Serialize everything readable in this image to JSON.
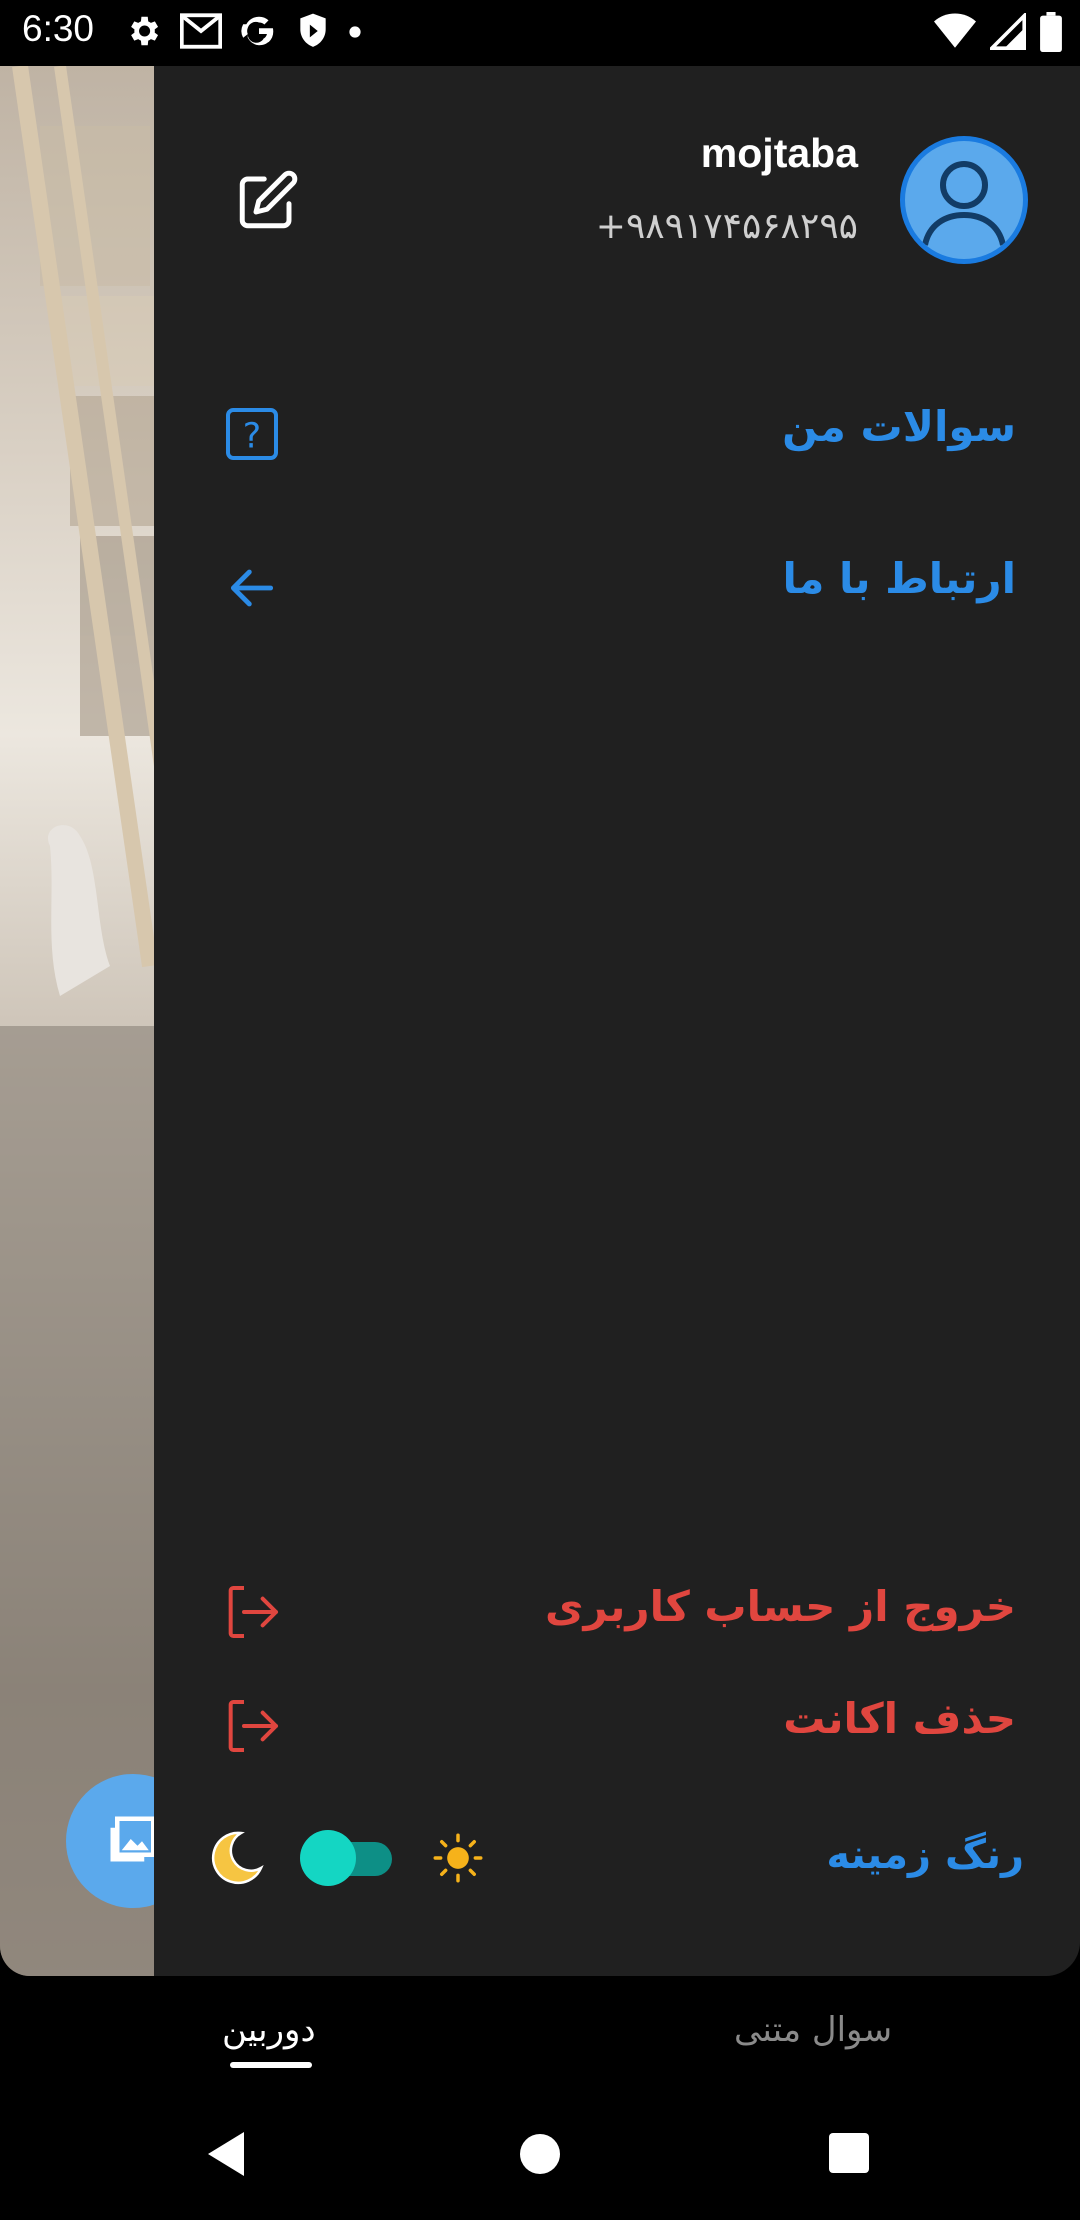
{
  "status_bar": {
    "time": "6:30",
    "left_icons": [
      "settings-icon",
      "gmail-icon",
      "google-icon",
      "shield-icon",
      "dot-icon"
    ],
    "right_icons": [
      "wifi-icon",
      "signal-icon",
      "battery-icon"
    ]
  },
  "drawer": {
    "profile": {
      "name": "mojtaba",
      "phone": "+۹۸۹۱۷۴۵۶۸۲۹۵"
    },
    "menu": {
      "my_questions": "سوالات من",
      "contact_us": "ارتباط با ما",
      "logout": "خروج از حساب کاربری",
      "delete_account": "حذف اکانت"
    },
    "theme": {
      "label": "رنگ زمینه",
      "toggle_on": true
    }
  },
  "tabs": {
    "camera": "دوربین",
    "text_question": "سوال متنی",
    "active": "camera"
  },
  "colors": {
    "accent_blue": "#2b8be6",
    "danger_red": "#e0463f",
    "drawer_bg": "#202020",
    "toggle_teal": "#14d6c3"
  }
}
